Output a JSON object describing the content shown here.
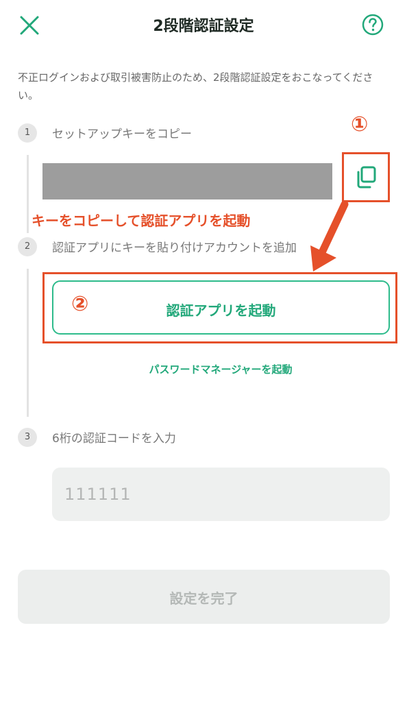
{
  "header": {
    "title": "2段階認証設定",
    "close_icon": "close-icon",
    "help_icon": "help-icon"
  },
  "intro": "不正ログインおよび取引被害防止のため、2段階認証設定をおこなってください。",
  "steps": [
    {
      "number": "1",
      "label": "セットアップキーをコピー"
    },
    {
      "number": "2",
      "label": "認証アプリにキーを貼り付けアカウントを追加"
    },
    {
      "number": "3",
      "label": "6桁の認証コードを入力"
    }
  ],
  "copy_icon": "copy-icon",
  "annotations": {
    "instruction": "キーをコピーして認証アプリを起動",
    "mark1": "①",
    "mark2": "②",
    "color": "#e5502a"
  },
  "launch_app_label": "認証アプリを起動",
  "password_manager_label": "パスワードマネージャーを起動",
  "code_input": {
    "placeholder": "111111",
    "value": ""
  },
  "submit_label": "設定を完了",
  "colors": {
    "accent": "#22a87a",
    "annotation": "#e5502a"
  }
}
